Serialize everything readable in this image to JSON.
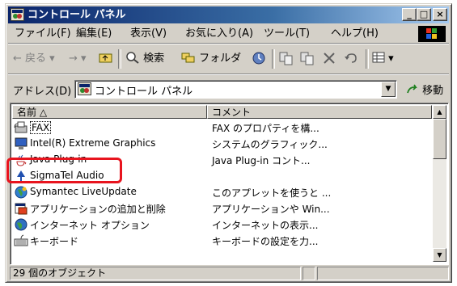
{
  "window": {
    "title": "コントロール パネル",
    "buttons": {
      "minimize": "_",
      "maximize": "□",
      "close": "×"
    }
  },
  "menubar": {
    "items": [
      "ファイル(F)",
      "編集(E)",
      "表示(V)",
      "お気に入り(A)",
      "ツール(T)",
      "ヘルプ(H)"
    ]
  },
  "toolbar": {
    "back": "← 戻る ▾",
    "forward": "→ ▾",
    "search": "検索",
    "folders": "フォルダ",
    "views": "▾"
  },
  "addressbar": {
    "label": "アドレス(D)",
    "value": "コントロール パネル",
    "go": "移動"
  },
  "list": {
    "columns": {
      "name": "名前 △",
      "comment": "コメント"
    },
    "rows": [
      {
        "name": "FAX",
        "comment": "FAX のプロパティを構...",
        "icon": "fax-icon"
      },
      {
        "name": "Intel(R) Extreme Graphics",
        "comment": "システムのグラフィック...",
        "icon": "display-icon"
      },
      {
        "name": "Java Plug-in",
        "comment": "Java Plug-in コント...",
        "icon": "java-icon"
      },
      {
        "name": "SigmaTel Audio",
        "comment": "",
        "icon": "audio-icon"
      },
      {
        "name": "Symantec LiveUpdate",
        "comment": "このアプレットを使うと ...",
        "icon": "globe-icon"
      },
      {
        "name": "アプリケーションの追加と削除",
        "comment": "アプリケーションや Win...",
        "icon": "add-remove-icon"
      },
      {
        "name": "インターネット オプション",
        "comment": "インターネットの表示...",
        "icon": "globe-icon"
      },
      {
        "name": "キーボード",
        "comment": "キーボードの設定を力...",
        "icon": "keyboard-icon"
      }
    ]
  },
  "statusbar": {
    "count": "29 個のオブジェクト"
  },
  "colors": {
    "highlight": "#e8141e",
    "titlebar": "#0a246a",
    "face": "#d4d0c8"
  }
}
